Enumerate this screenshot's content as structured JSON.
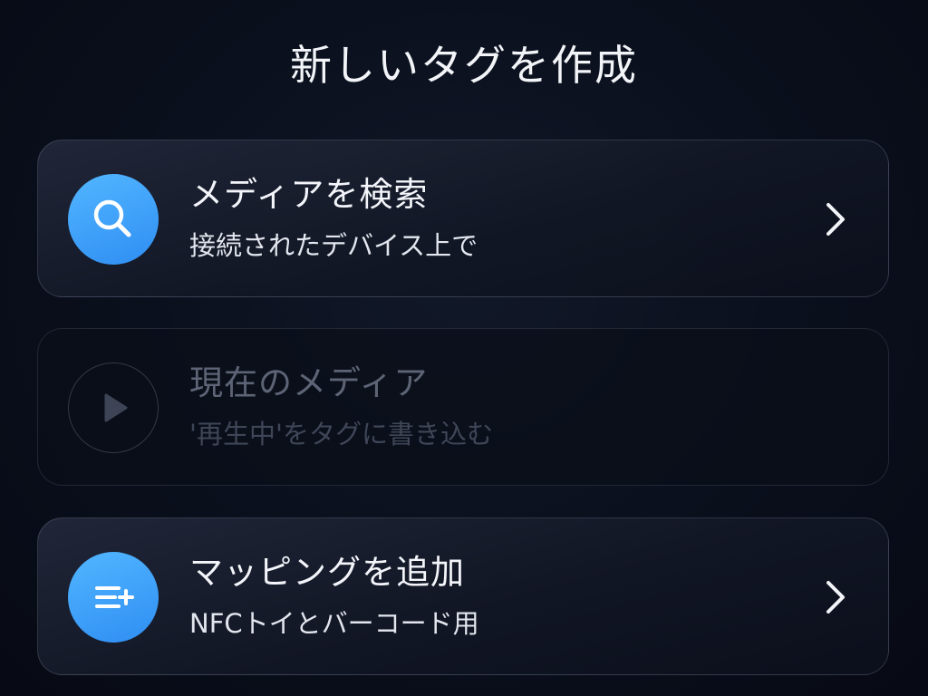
{
  "header": {
    "title": "新しいタグを作成"
  },
  "options": [
    {
      "title": "メディアを検索",
      "subtitle": "接続されたデバイス上で",
      "icon": "search-icon",
      "enabled": true
    },
    {
      "title": "現在のメディア",
      "subtitle": "'再生中'をタグに書き込む",
      "icon": "play-icon",
      "enabled": false
    },
    {
      "title": "マッピングを追加",
      "subtitle": "NFCトイとバーコード用",
      "icon": "add-list-icon",
      "enabled": true
    }
  ],
  "colors": {
    "accent": "#3a9cf7",
    "background": "#0a0f1c",
    "text": "#f2f4f8",
    "disabled_text": "#5d6475"
  }
}
